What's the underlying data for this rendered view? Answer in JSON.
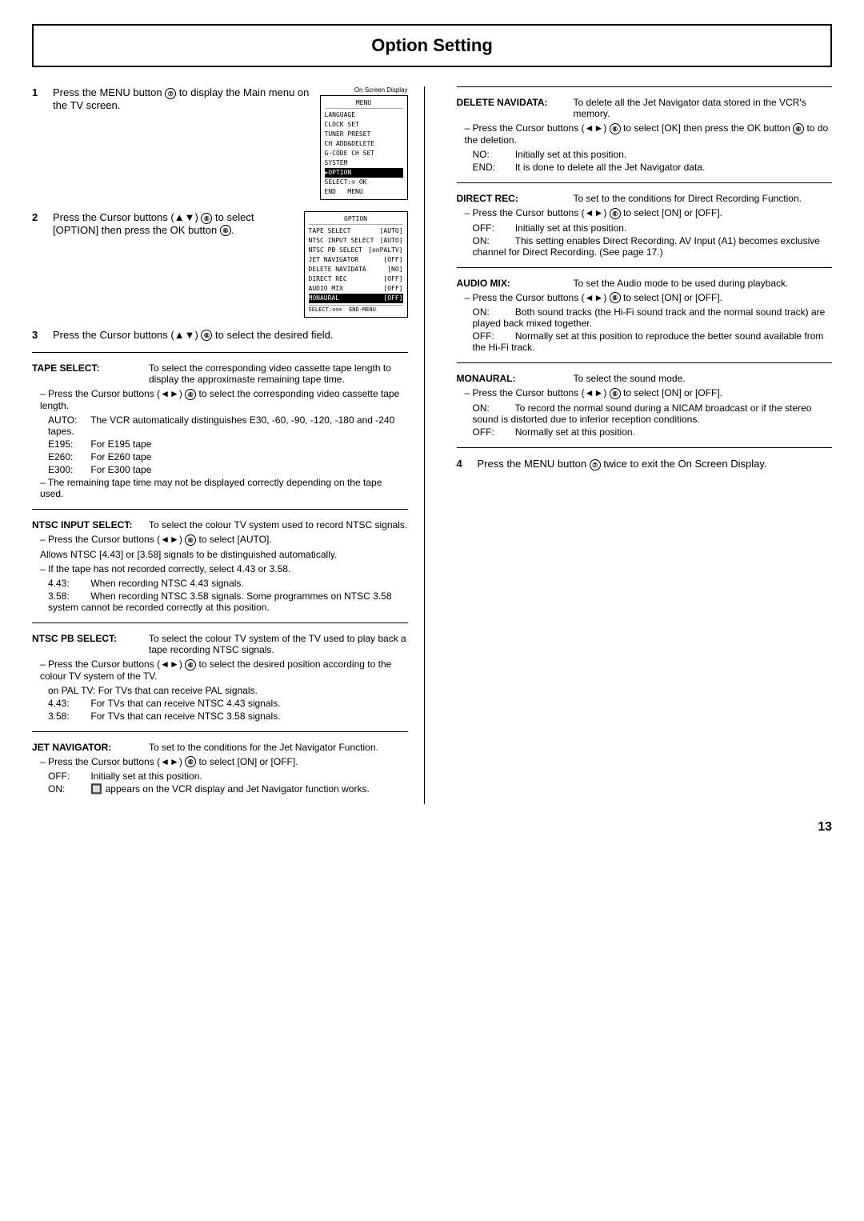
{
  "title": "Option Setting",
  "left": {
    "steps": [
      {
        "num": "1",
        "text": "Press the MENU button",
        "icon": "⑦",
        "text2": " to display the Main menu on the TV screen.",
        "screen_label": "On Screen Display",
        "screen_lines": [
          "MENU",
          "LANGUAGE",
          "CLOCK SET",
          "TUNER PRESET",
          "CH ADD&DELETE",
          "G-CODE CH SET",
          "SYSTEM",
          "►OPTION",
          "SELECT:⊙ OK",
          "END    MENU"
        ],
        "screen_highlight": "►OPTION"
      },
      {
        "num": "2",
        "text": "Press the Cursor buttons (▲▼)",
        "icon": "⑥",
        "text2": " to select [OPTION] then press the OK button",
        "icon2": "⑥",
        "text3": ".",
        "option_lines": [
          {
            "label": "TAPE SELECT",
            "val": "[AUTO]"
          },
          {
            "label": "NTSC INPUT SELECT",
            "val": "[AUTO]"
          },
          {
            "label": "NTSC PB SELECT",
            "val": "[onPALTV]"
          },
          {
            "label": "JET NAVIGATOR",
            "val": "[OFF]"
          },
          {
            "label": "DELETE NAVIDATA",
            "val": "[NO]"
          },
          {
            "label": "DIRECT REC",
            "val": "[OFF]"
          },
          {
            "label": "AUDIO MIX",
            "val": "[OFF]"
          },
          {
            "label": "MONAURAL",
            "val": "[OFF]"
          }
        ],
        "option_label": "OPTION",
        "option_footer": "SELECT:⊙⊙⊙  END·MENU"
      },
      {
        "num": "3",
        "text": "Press the Cursor buttons (▲▼)",
        "icon": "⑥",
        "text2": " to select the desired field."
      }
    ],
    "sections": [
      {
        "id": "tape-select",
        "label": "TAPE SELECT:",
        "desc": "To select the corresponding video cassette tape length to display the approximaste remaining tape time.",
        "bullets": [
          "– Press the Cursor buttons (◄►) ⑥ to select the corresponding video cassette tape length.",
          "AUTO:  The VCR automatically distinguishes E30, -60, -90, -120, -180 and -240 tapes.",
          "E195:  For E195 tape",
          "E260:  For E260 tape",
          "E300:  For E300 tape"
        ],
        "note": "– The remaining tape time may not be displayed correctly depending on the tape used."
      },
      {
        "id": "ntsc-input",
        "label": "NTSC INPUT SELECT:",
        "desc": "To select the colour TV system used to record NTSC signals.",
        "bullets": [
          "– Press the Cursor buttons (◄►) ⑥ to select [AUTO].",
          "Allows NTSC [4.43] or [3.58] signals to be distinguished automatically.",
          "– If the tape has not recorded correctly, select 4.43 or 3.58.",
          "4.43:  When recording NTSC 4.43 signals.",
          "3.58:  When recording NTSC 3.58 signals. Some programmes on NTSC 3.58 system cannot be recorded correctly at this position."
        ]
      },
      {
        "id": "ntsc-pb",
        "label": "NTSC PB SELECT:",
        "desc": "To select the colour TV system of the TV used to play back a tape recording NTSC signals.",
        "bullets": [
          "– Press the Cursor buttons (◄►) ⑥ to select the desired position according to the colour TV system of the TV.",
          "on PAL TV:  For TVs that can receive PAL signals.",
          "4.43:  For TVs that can receive NTSC 4.43 signals.",
          "3.58:  For TVs that can receive NTSC 3.58 signals."
        ]
      },
      {
        "id": "jet-nav",
        "label": "JET NAVIGATOR:",
        "desc": "To set to the conditions for the Jet Navigator Function.",
        "bullets": [
          "– Press the Cursor buttons (◄►) ⑥ to select [ON] or [OFF].",
          "OFF:  Initially set at this position.",
          "ON:   🔲 appears on the VCR display and Jet Navigator function works."
        ]
      }
    ]
  },
  "right": {
    "sections": [
      {
        "id": "delete-navidata",
        "label": "DELETE NAVIDATA:",
        "desc": "To delete all the Jet Navigator data stored in the VCR's memory.",
        "bullets": [
          "– Press the Cursor buttons (◄►) ⑥ to select [OK] then press the OK button ⑥ to do the deletion.",
          "NO:   Initially set at this position.",
          "END:  It is done to delete all the Jet Navigator data."
        ]
      },
      {
        "id": "direct-rec",
        "label": "DIRECT REC:",
        "desc": "To set to the conditions for Direct Recording Function.",
        "bullets": [
          "– Press the Cursor buttons (◄►) ⑥ to select [ON] or [OFF].",
          "OFF:  Initially set at this position.",
          "ON:   This setting enables Direct Recording. AV Input (A1) becomes exclusive channel for Direct Recording. (See page 17.)"
        ]
      },
      {
        "id": "audio-mix",
        "label": "AUDIO MIX:",
        "desc": "To set the Audio mode to be used during playback.",
        "bullets": [
          "– Press the Cursor buttons (◄►) ⑥ to select [ON] or [OFF].",
          "ON:   Both sound tracks (the Hi-Fi sound track and the normal sound track) are played back mixed together.",
          "OFF:  Normally set at this position to reproduce the better sound available from the Hi-Fi track."
        ]
      },
      {
        "id": "monaural",
        "label": "MONAURAL:",
        "desc": "To select the sound mode.",
        "bullets": [
          "– Press the Cursor buttons (◄►) ⑥ to select [ON] or [OFF].",
          "ON:   To record the normal sound during a NICAM broadcast or if the stereo sound is distorted due to inferior reception conditions.",
          "OFF:  Normally set at this position."
        ]
      }
    ],
    "step4": {
      "num": "4",
      "text": "Press the MENU button ⑦ twice to exit the On Screen Display."
    }
  },
  "page_number": "13"
}
